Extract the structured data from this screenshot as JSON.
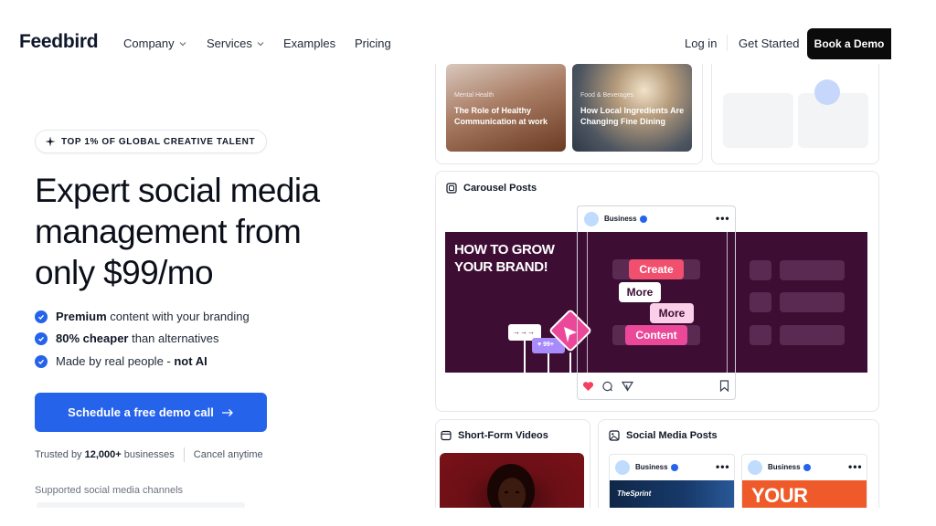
{
  "nav": {
    "logo": "Feedbird",
    "links": [
      {
        "label": "Company",
        "has_dropdown": true
      },
      {
        "label": "Services",
        "has_dropdown": true
      },
      {
        "label": "Examples",
        "has_dropdown": false
      },
      {
        "label": "Pricing",
        "has_dropdown": false
      }
    ],
    "login": "Log in",
    "get_started": "Get Started",
    "book_demo": "Book a Demo"
  },
  "hero": {
    "badge": "TOP 1% OF GLOBAL CREATIVE TALENT",
    "title": "Expert social media management from only $99/mo",
    "features": [
      {
        "bold": "Premium",
        "rest": " content with your branding"
      },
      {
        "bold": "80% cheaper",
        "rest": " than alternatives"
      },
      {
        "pre": "Made by real people - ",
        "bold": "not AI"
      }
    ],
    "cta": "Schedule a free demo call",
    "trust_pre": "Trusted by ",
    "trust_bold": "12,000+",
    "trust_post": " businesses",
    "trust_cancel": "Cancel anytime",
    "supported": "Supported social media channels"
  },
  "collage": {
    "blog_cards": [
      {
        "category": "Mental Health",
        "title": "The Role of Healthy Communication at work"
      },
      {
        "category": "Food & Beverages",
        "title": "How Local Ingredients Are Changing Fine Dining"
      }
    ],
    "carousel": {
      "heading": "Carousel Posts",
      "slide_text": "HOW TO GROW YOUR BRAND!",
      "account": "Business",
      "pills": [
        "Create",
        "More",
        "More",
        "Content"
      ],
      "tag_arrows": "→→→",
      "tag_likes": "♥ 99+"
    },
    "short_form": {
      "heading": "Short-Form Videos"
    },
    "social_posts": {
      "heading": "Social Media Posts",
      "account": "Business",
      "card1_brand": "TheSprint",
      "card2_text": "YOUR"
    }
  },
  "colors": {
    "accent": "#2563eb",
    "dark": "#0b0b0b",
    "carousel_bg": "#3d0d34",
    "pink": "#ec4899",
    "coral": "#f0506e"
  }
}
